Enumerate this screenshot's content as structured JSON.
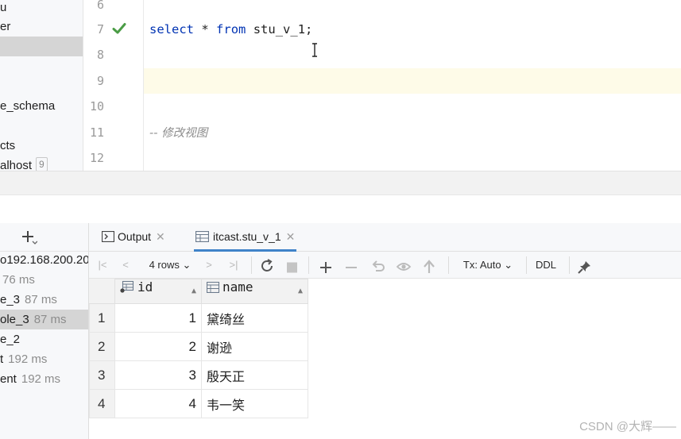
{
  "schema_tree": {
    "items": [
      {
        "label": "u"
      },
      {
        "label": "er"
      },
      {
        "label": ""
      },
      {
        "label": "e_schema"
      },
      {
        "label": "cts"
      },
      {
        "label": "alhost",
        "badge": "9"
      }
    ]
  },
  "editor": {
    "lines": [
      {
        "no": "6",
        "text": ""
      },
      {
        "no": "7",
        "text": "select * from stu_v_1;"
      },
      {
        "no": "8",
        "text": ""
      },
      {
        "no": "9",
        "text": ""
      },
      {
        "no": "10",
        "text": ""
      },
      {
        "no": "11",
        "text": "-- 修改视图"
      },
      {
        "no": "12",
        "text": ""
      }
    ],
    "code": {
      "kw_select": "select",
      "star": "*",
      "kw_from": "from",
      "table": "stu_v_1;"
    },
    "comment": "-- 修改视图"
  },
  "services": {
    "add_label": "+",
    "items": [
      {
        "label": "o192.168.200.20",
        "ms": ""
      },
      {
        "label": "",
        "ms": "76 ms"
      },
      {
        "label": "e_3",
        "ms": "87 ms"
      },
      {
        "label": "ole_3",
        "ms": "87 ms"
      },
      {
        "label": "e_2",
        "ms": ""
      },
      {
        "label": "t",
        "ms": "192 ms"
      },
      {
        "label": "ent",
        "ms": "192 ms"
      }
    ]
  },
  "results": {
    "tabs": [
      {
        "label": "Output"
      },
      {
        "label": "itcast.stu_v_1"
      }
    ],
    "toolbar": {
      "rows_label": "4 rows",
      "tx_label": "Tx: Auto",
      "ddl_label": "DDL"
    },
    "columns": [
      "id",
      "name"
    ],
    "rows": [
      {
        "num": "1",
        "id": "1",
        "name": "黛绮丝"
      },
      {
        "num": "2",
        "id": "2",
        "name": "谢逊"
      },
      {
        "num": "3",
        "id": "3",
        "name": "殷天正"
      },
      {
        "num": "4",
        "id": "4",
        "name": "韦一笑"
      }
    ]
  },
  "watermark": "CSDN @大辉——"
}
